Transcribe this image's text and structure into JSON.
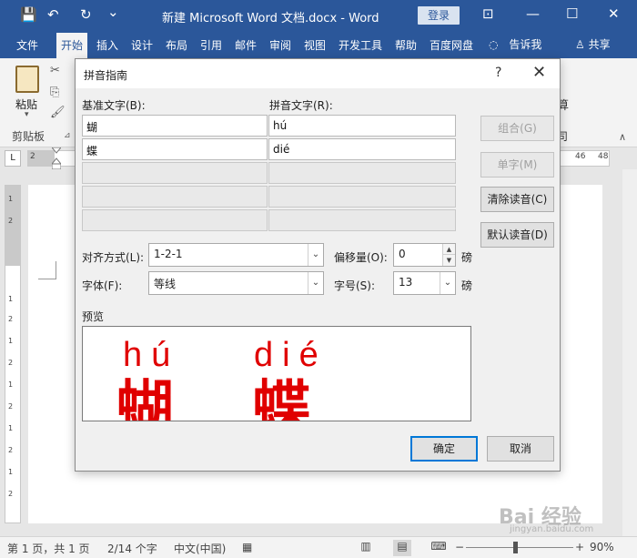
{
  "window": {
    "title": "新建 Microsoft Word 文档.docx  -  Word",
    "login": "登录",
    "quick_access": {
      "save": "💾",
      "undo": "↶",
      "redo": "↻",
      "customize": "⌄"
    },
    "controls": {
      "ribbon_options": "⊡",
      "minimize": "—",
      "maximize": "☐",
      "close": "✕"
    }
  },
  "ribbon": {
    "tabs": [
      "文件",
      "开始",
      "插入",
      "设计",
      "布局",
      "引用",
      "邮件",
      "审阅",
      "视图",
      "开发工具",
      "帮助",
      "百度网盘"
    ],
    "active_tab": "开始",
    "tell_me": "告诉我",
    "share": "共享",
    "clipboard": {
      "paste": "粘贴",
      "paste_caret": "▾",
      "cut": "✂",
      "copy": "⎘",
      "format_painter": "🖌",
      "group_label": "剪贴板",
      "launcher": "⊿"
    },
    "right_partial": {
      "top": "算",
      "bottom": "司"
    },
    "collapse": "∧"
  },
  "ruler": {
    "corner": "L",
    "numbers_left": [
      "2"
    ],
    "numbers_right": [
      "46",
      "48"
    ],
    "vertical_numbers": [
      "1",
      "2",
      "1",
      "2",
      "1",
      "2",
      "1",
      "2",
      "1",
      "2",
      "1",
      "2",
      "1",
      "2"
    ]
  },
  "dialog": {
    "title": "拼音指南",
    "help": "?",
    "close": "✕",
    "base_text_label": "基准文字(B):",
    "ruby_text_label": "拼音文字(R):",
    "rows": [
      {
        "base": "蝴",
        "ruby": "hú"
      },
      {
        "base": "蝶",
        "ruby": "dié"
      },
      {
        "base": "",
        "ruby": ""
      },
      {
        "base": "",
        "ruby": ""
      },
      {
        "base": "",
        "ruby": ""
      }
    ],
    "buttons": {
      "group": "组合(G)",
      "mono": "单字(M)",
      "clear": "清除读音(C)",
      "default": "默认读音(D)",
      "ok": "确定",
      "cancel": "取消"
    },
    "alignment_label": "对齐方式(L):",
    "alignment_value": "1-2-1",
    "offset_label": "偏移量(O):",
    "offset_value": "0",
    "offset_unit": "磅",
    "font_label": "字体(F):",
    "font_value": "等线",
    "size_label": "字号(S):",
    "size_value": "13",
    "size_unit": "磅",
    "preview_label": "预览",
    "preview": {
      "pinyin1": "hú",
      "pinyin2": "dié",
      "char1": "蝴",
      "char2": "蝶"
    },
    "combo_arrow": "⌄",
    "spin_up": "▲",
    "spin_down": "▼"
  },
  "statusbar": {
    "page": "第 1 页，共 1 页",
    "words": "2/14 个字",
    "language": "中文(中国)",
    "macro_icon": "▦",
    "view_read": "▥",
    "view_print": "▤",
    "view_web": "⌨",
    "zoom_out": "−",
    "zoom_in": "+",
    "zoom": "90%"
  },
  "watermark": {
    "text": "Bai 经验",
    "sub": "jingyan.baidu.com"
  },
  "colors": {
    "word_blue": "#2b579a",
    "preview_red": "#e00000",
    "focus_blue": "#0078d7"
  }
}
